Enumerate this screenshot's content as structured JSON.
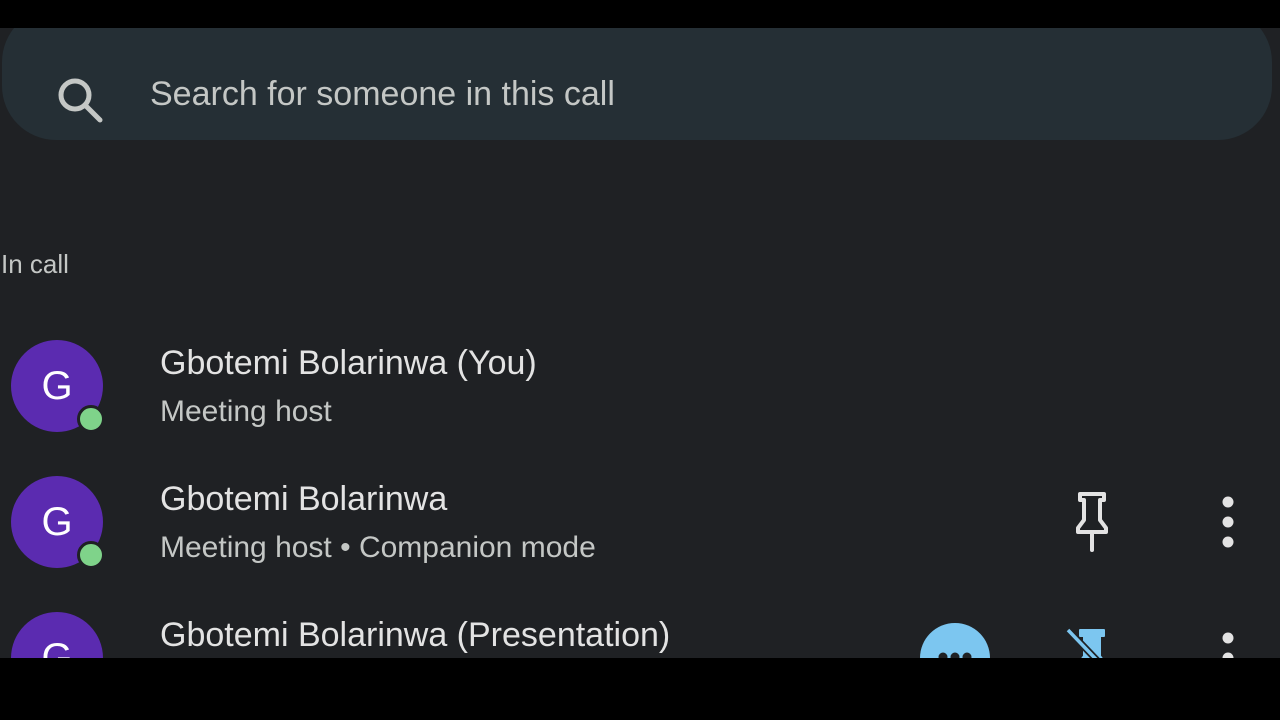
{
  "search": {
    "placeholder": "Search for someone in this call",
    "icon": "search-icon"
  },
  "section": {
    "label": "In call"
  },
  "participants": [
    {
      "initial": "G",
      "name": "Gbotemi Bolarinwa (You)",
      "subtitle": "Meeting host",
      "online": true,
      "avatar_color": "#5b2bb0"
    },
    {
      "initial": "G",
      "name": "Gbotemi Bolarinwa",
      "subtitle": "Meeting host • Companion mode",
      "online": true,
      "avatar_color": "#5b2bb0",
      "actions": [
        "pin-icon",
        "more-vert-icon"
      ]
    },
    {
      "initial": "G",
      "name": "Gbotemi Bolarinwa (Presentation)",
      "actions": [
        "presenting-icon",
        "unpin-icon",
        "more-vert-icon"
      ]
    }
  ],
  "colors": {
    "background": "#1f2124",
    "search_bar": "#252f35",
    "avatar": "#5b2bb0",
    "online_dot": "#7fd38a",
    "presenting_badge": "#7cc6f0",
    "text_primary": "#e3e3e3",
    "text_secondary": "#c4c7c5"
  }
}
